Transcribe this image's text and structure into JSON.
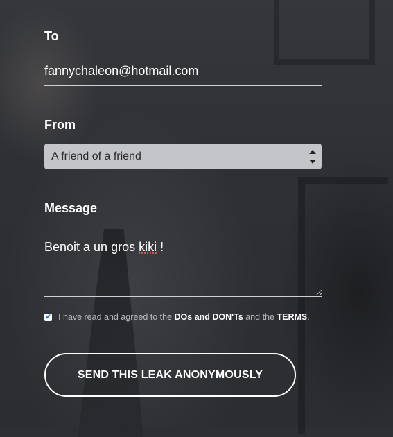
{
  "form": {
    "to_label": "To",
    "to_value": "fannychaleon@hotmail.com",
    "from_label": "From",
    "from_selected": "A friend of a friend",
    "message_label": "Message",
    "message_text_before": "Benoit a un gros ",
    "message_text_misspelled": "kiki",
    "message_text_after": " !",
    "agreement": {
      "checked": true,
      "check_glyph": "✔",
      "text_1": "I have read and agreed to the ",
      "link_dos": "DOs and DON'Ts",
      "text_2": " and the ",
      "link_terms": "TERMS",
      "text_3": "."
    },
    "send_label": "SEND THIS LEAK ANONYMOUSLY"
  },
  "colors": {
    "background": "#2d2f33",
    "select_bg": "#c4c5c8",
    "checkbox_check": "#2a6fd6",
    "spellcheck": "#e25a4e"
  },
  "icons": {
    "select_arrows": "select-arrows-icon",
    "checkbox": "checkmark-icon",
    "resize": "resize-grip-icon"
  }
}
